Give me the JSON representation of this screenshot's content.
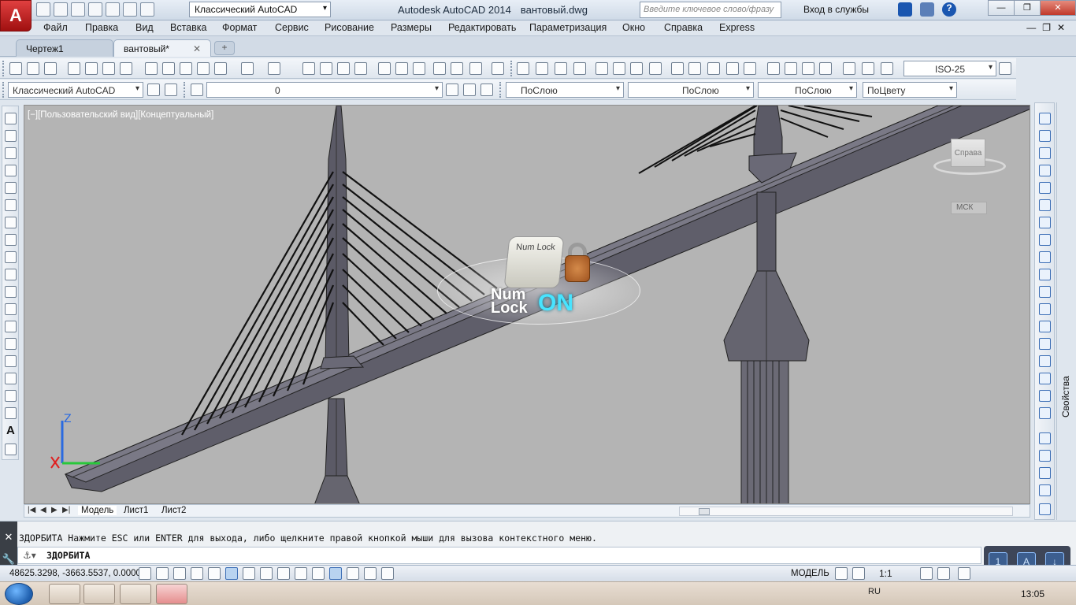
{
  "app": {
    "logo_letter": "A",
    "workspace": "Классический AutoCAD",
    "product": "Autodesk AutoCAD 2014",
    "filename": "вантовый.dwg",
    "search_placeholder": "Введите ключевое слово/фразу",
    "login": "Вход в службы",
    "help_icon": "?"
  },
  "menu": [
    "Файл",
    "Правка",
    "Вид",
    "Вставка",
    "Формат",
    "Сервис",
    "Рисование",
    "Размеры",
    "Редактировать",
    "Параметризация",
    "Окно",
    "Справка",
    "Express"
  ],
  "tabs": [
    {
      "label": "Чертеж1",
      "active": false
    },
    {
      "label": "вантовый*",
      "active": true
    }
  ],
  "toolbar1": {
    "dimstyle": "ISO-25"
  },
  "toolbar2": {
    "workspace": "Классический AutoCAD",
    "layer": "0",
    "color": "ПоСлою",
    "linetype": "ПоСлою",
    "lineweight": "ПоСлою",
    "plotstyle": "ПоЦвету"
  },
  "viewport": {
    "label": "[−][Пользовательский вид][Концептуальный]",
    "viewcube_face": "Справа",
    "wcs": "МСК",
    "ucs_z": "Z",
    "numlock_key": "Num Lock",
    "numlock_line1": "Num",
    "numlock_line2": "Lock",
    "numlock_state": "ON"
  },
  "layout_tabs": [
    "Модель",
    "Лист1",
    "Лист2"
  ],
  "properties_label": "Свойства",
  "command": {
    "history": "3ДОРБИТА Нажмите ESC или ENTER для выхода, либо щелкните правой кнопкой мыши для вызова контекстного меню.",
    "current": "3ДОРБИТА"
  },
  "status": {
    "coords": "48625.3298, -3663.5537, 0.0000",
    "space": "МОДЕЛЬ",
    "scale": "1:1"
  },
  "taskbar": {
    "lang": "RU",
    "time": "13:05"
  },
  "float_panel": [
    "1",
    "A",
    "↓"
  ]
}
